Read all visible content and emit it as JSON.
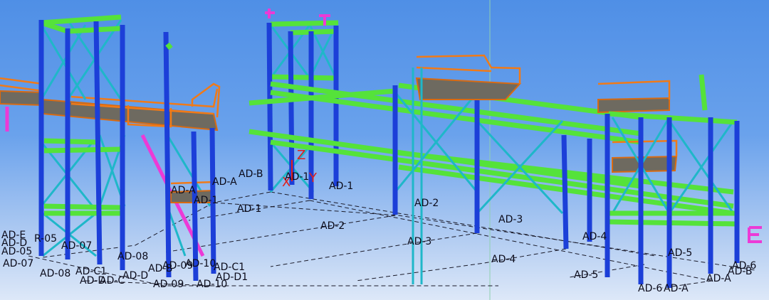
{
  "viewport": {
    "background_top": "#4f8fe6",
    "background_bottom": "#dde8f8",
    "column_color": "#1c3fd8",
    "beam_color": "#55e23a",
    "brace_color": "#1fb7c9",
    "railing_color": "#f07a18",
    "grid_line_color": "#1b1b2a",
    "coordinate_axis_color": "#e0201c"
  },
  "axes": {
    "z": "Z",
    "x": "X",
    "y": "Y"
  },
  "grid_labels": {
    "ad_b_top": "AD-B",
    "ad_a_top": "AD-A",
    "ad_1_top": "AD-1",
    "ad_1_axis": "AD-1",
    "ad_1_mid": "AD-1",
    "ad_a_left": "AD-A",
    "ad_1_left": "AD-1",
    "ad_2_top": "AD-2",
    "ad_2_mid": "AD-2",
    "ad_3_top": "AD-3",
    "ad_3_mid": "AD-3",
    "ad_4_top": "AD-4",
    "ad_4_mid": "AD-4",
    "ad_5_top": "AD-5",
    "ad_5_mid": "AD-5",
    "ad_6_top": "AD-6",
    "ad_6_bot": "AD-6",
    "ad_a_right": "AD-A",
    "ad_a_right2": "AD-A",
    "ad_b_right": "AD-B",
    "ad_e_stack": "AD-E",
    "ad_r05": "R-05",
    "ad_d_stack": "AD-D",
    "ad_05_stack": "AD-05",
    "ad_07_a": "AD-07",
    "ad_07_b": "AD-07",
    "ad_08_a": "AD-08",
    "ad_08_b": "AD-08",
    "ad_09_a": "AD-09",
    "ad_09_b": "AD-09",
    "ad_10_a": "AD-10",
    "ad_10_b": "AD-10",
    "ad_c1_a": "AD-C1",
    "ad_c1_b": "AD-C1",
    "ad_d1": "AD-D1",
    "ad_d_b": "AD-D",
    "ad_c_b": "AD-C",
    "ad_d_c": "AD-D",
    "ad_b_c": "AD-B"
  }
}
